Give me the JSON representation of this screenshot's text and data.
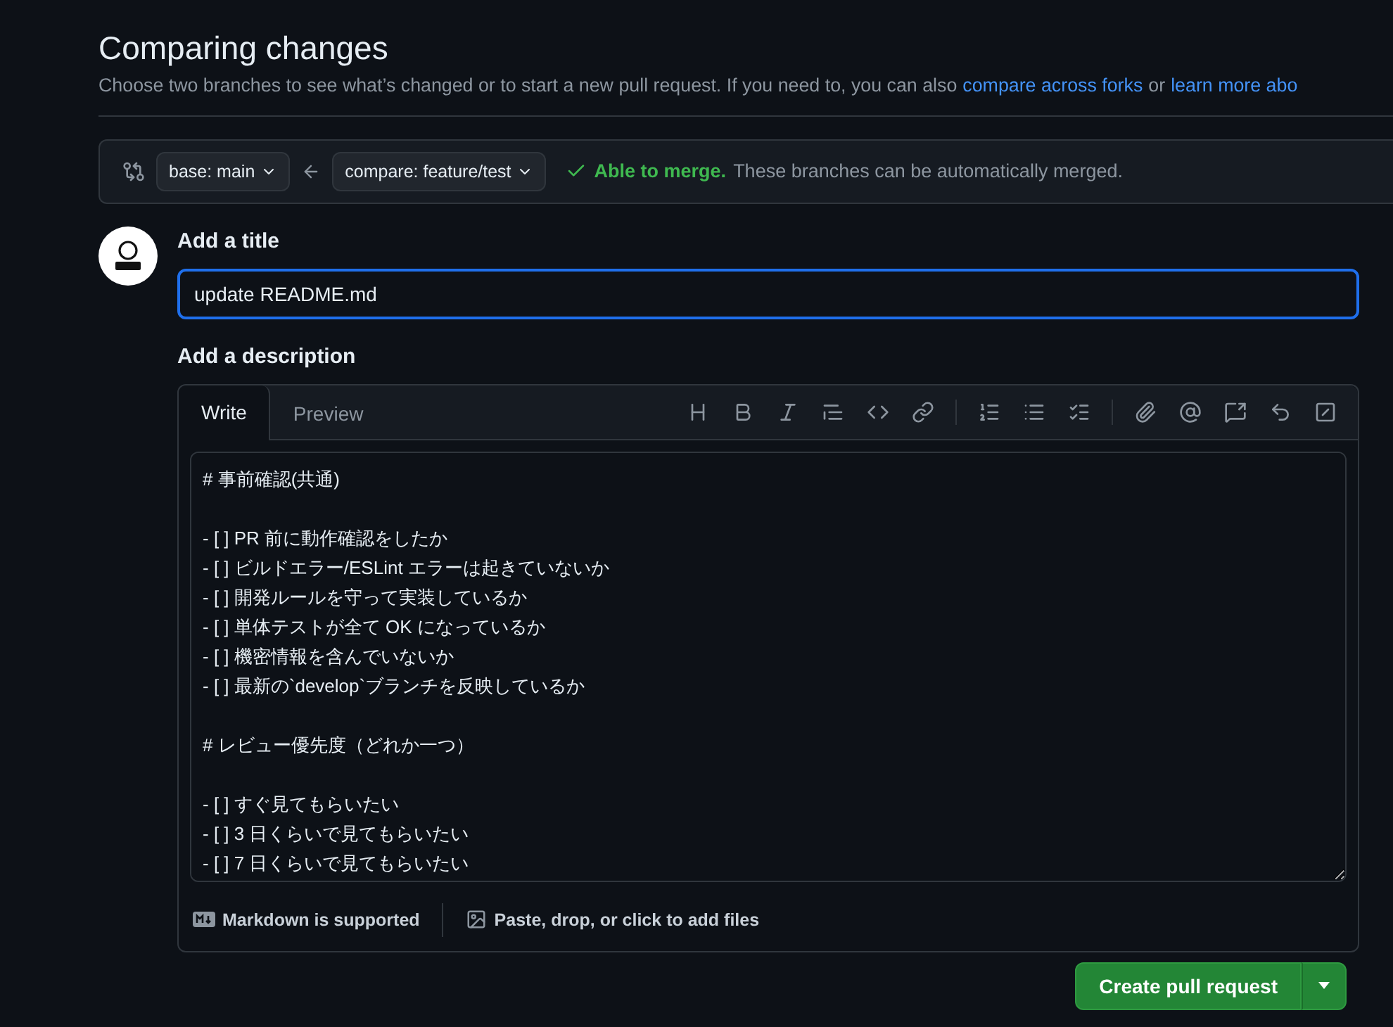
{
  "header": {
    "title": "Comparing changes",
    "subtitle": "Choose two branches to see what’s changed or to start a new pull request. If you need to, you can also",
    "links": [
      "compare across forks",
      "learn more abo"
    ],
    "link_joiner": "or"
  },
  "compare_bar": {
    "base": "base: main",
    "compare": "compare: feature/test",
    "status": {
      "kind": "mergeable",
      "headline": "Able to merge.",
      "message": "These branches can be automatically merged."
    }
  },
  "form": {
    "title_label": "Add a title",
    "title_value": "update README.md",
    "description_label": "Add a description",
    "tabs": [
      {
        "label": "Write",
        "selected": true
      },
      {
        "label": "Preview",
        "selected": false
      }
    ],
    "toolbar": [
      {
        "kind": "heading"
      },
      {
        "kind": "bold"
      },
      {
        "kind": "italic"
      },
      {
        "kind": "quote"
      },
      {
        "kind": "code"
      },
      {
        "kind": "link"
      },
      {
        "kind": "sep"
      },
      {
        "kind": "ordered"
      },
      {
        "kind": "unordered"
      },
      {
        "kind": "tasks"
      },
      {
        "kind": "sep"
      },
      {
        "kind": "attach"
      },
      {
        "kind": "mention"
      },
      {
        "kind": "reference"
      },
      {
        "kind": "reply"
      },
      {
        "kind": "slash"
      }
    ],
    "description": "# 事前確認(共通)\n\n- [ ] PR 前に動作確認をしたか\n- [ ] ビルドエラー/ESLint エラーは起きていないか\n- [ ] 開発ルールを守って実装しているか\n- [ ] 単体テストが全て OK になっているか\n- [ ] 機密情報を含んでいないか\n- [ ] 最新の`develop`ブランチを反映しているか\n\n# レビュー優先度（どれか一つ）\n\n- [ ] すぐ見てもらいたい\n- [ ] 3 日くらいで見てもらいたい\n- [ ] 7 日くらいで見てもらいたい",
    "footer": {
      "markdown": "Markdown is supported",
      "attach": "Paste, drop, or click to add files"
    },
    "submit": "Create pull request"
  }
}
